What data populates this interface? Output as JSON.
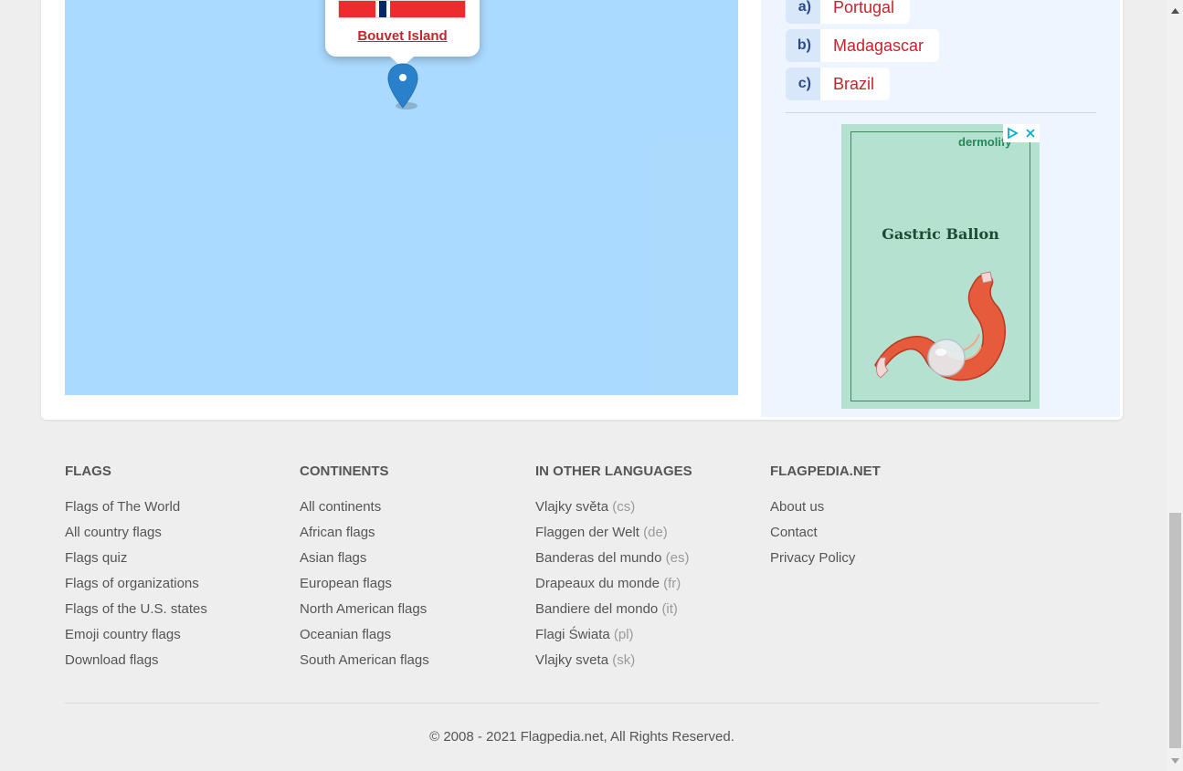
{
  "map": {
    "popup_link": "Bouvet Island",
    "colors": {
      "water": "#aadaff",
      "marker": "#2a81cb"
    }
  },
  "quiz": {
    "options": [
      {
        "letter": "a)",
        "text": "Portugal"
      },
      {
        "letter": "b)",
        "text": "Madagascar"
      },
      {
        "letter": "c)",
        "text": "Brazil"
      }
    ]
  },
  "ad": {
    "brand": "dermolify",
    "title": "Gastric Ballon",
    "icons": [
      "adchoices-icon",
      "close-icon"
    ]
  },
  "footer": {
    "columns": [
      {
        "heading": "FLAGS",
        "items": [
          "Flags of The World",
          "All country flags",
          "Flags quiz",
          "Flags of organizations",
          "Flags of the U.S. states",
          "Emoji country flags",
          "Download flags"
        ]
      },
      {
        "heading": "CONTINENTS",
        "items": [
          "All continents",
          "African flags",
          "Asian flags",
          "European flags",
          "North American flags",
          "Oceanian flags",
          "South American flags"
        ]
      },
      {
        "heading": "IN OTHER LANGUAGES",
        "items": [
          {
            "text": "Vlajky světa",
            "code": "(cs)"
          },
          {
            "text": "Flaggen der Welt",
            "code": "(de)"
          },
          {
            "text": "Banderas del mundo",
            "code": "(es)"
          },
          {
            "text": "Drapeaux du monde",
            "code": "(fr)"
          },
          {
            "text": "Bandiere del mondo",
            "code": "(it)"
          },
          {
            "text": "Flagi Świata",
            "code": "(pl)"
          },
          {
            "text": "Vlajky sveta",
            "code": "(sk)"
          }
        ]
      },
      {
        "heading": "FLAGPEDIA.NET",
        "items": [
          "About us",
          "Contact",
          "Privacy Policy"
        ]
      }
    ],
    "copyright": "© 2008 - 2021 Flagpedia.net, All Rights Reserved."
  },
  "colors": {
    "accent_red": "#c0272d",
    "text_gray": "#555555",
    "quiz_bg": "#eef5ff",
    "page_bg": "#eeeeee"
  }
}
